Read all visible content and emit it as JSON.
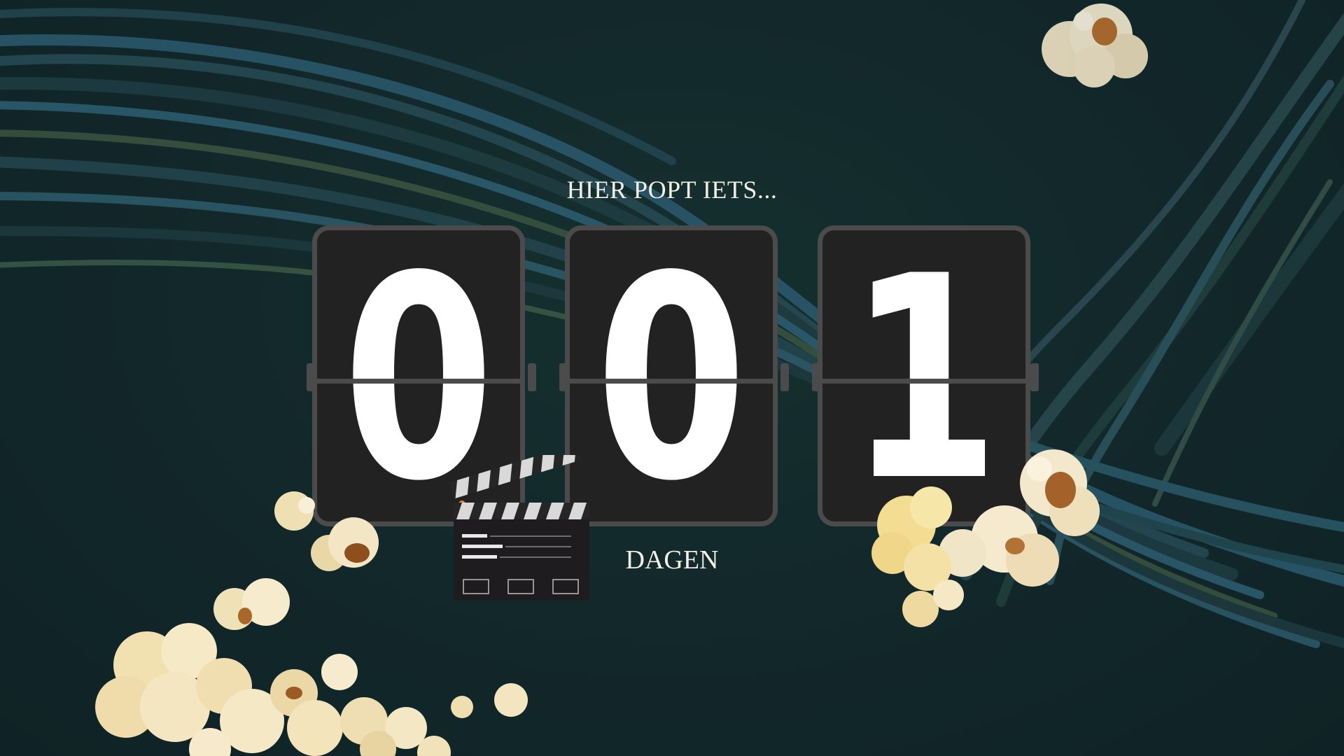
{
  "headline": "HIER POPT IETS...",
  "countdown": {
    "digits": [
      "0",
      "0",
      "1"
    ],
    "unit_label": "DAGEN"
  },
  "decorations": {
    "background": "dark-teal-cable-swirl",
    "icons": [
      "clapperboard-icon",
      "popcorn-cluster"
    ]
  },
  "colors": {
    "background": "#12272a",
    "card": "#222222",
    "card_border": "#4b4b4b",
    "digit": "#ffffff",
    "text": "#f3efe6"
  }
}
